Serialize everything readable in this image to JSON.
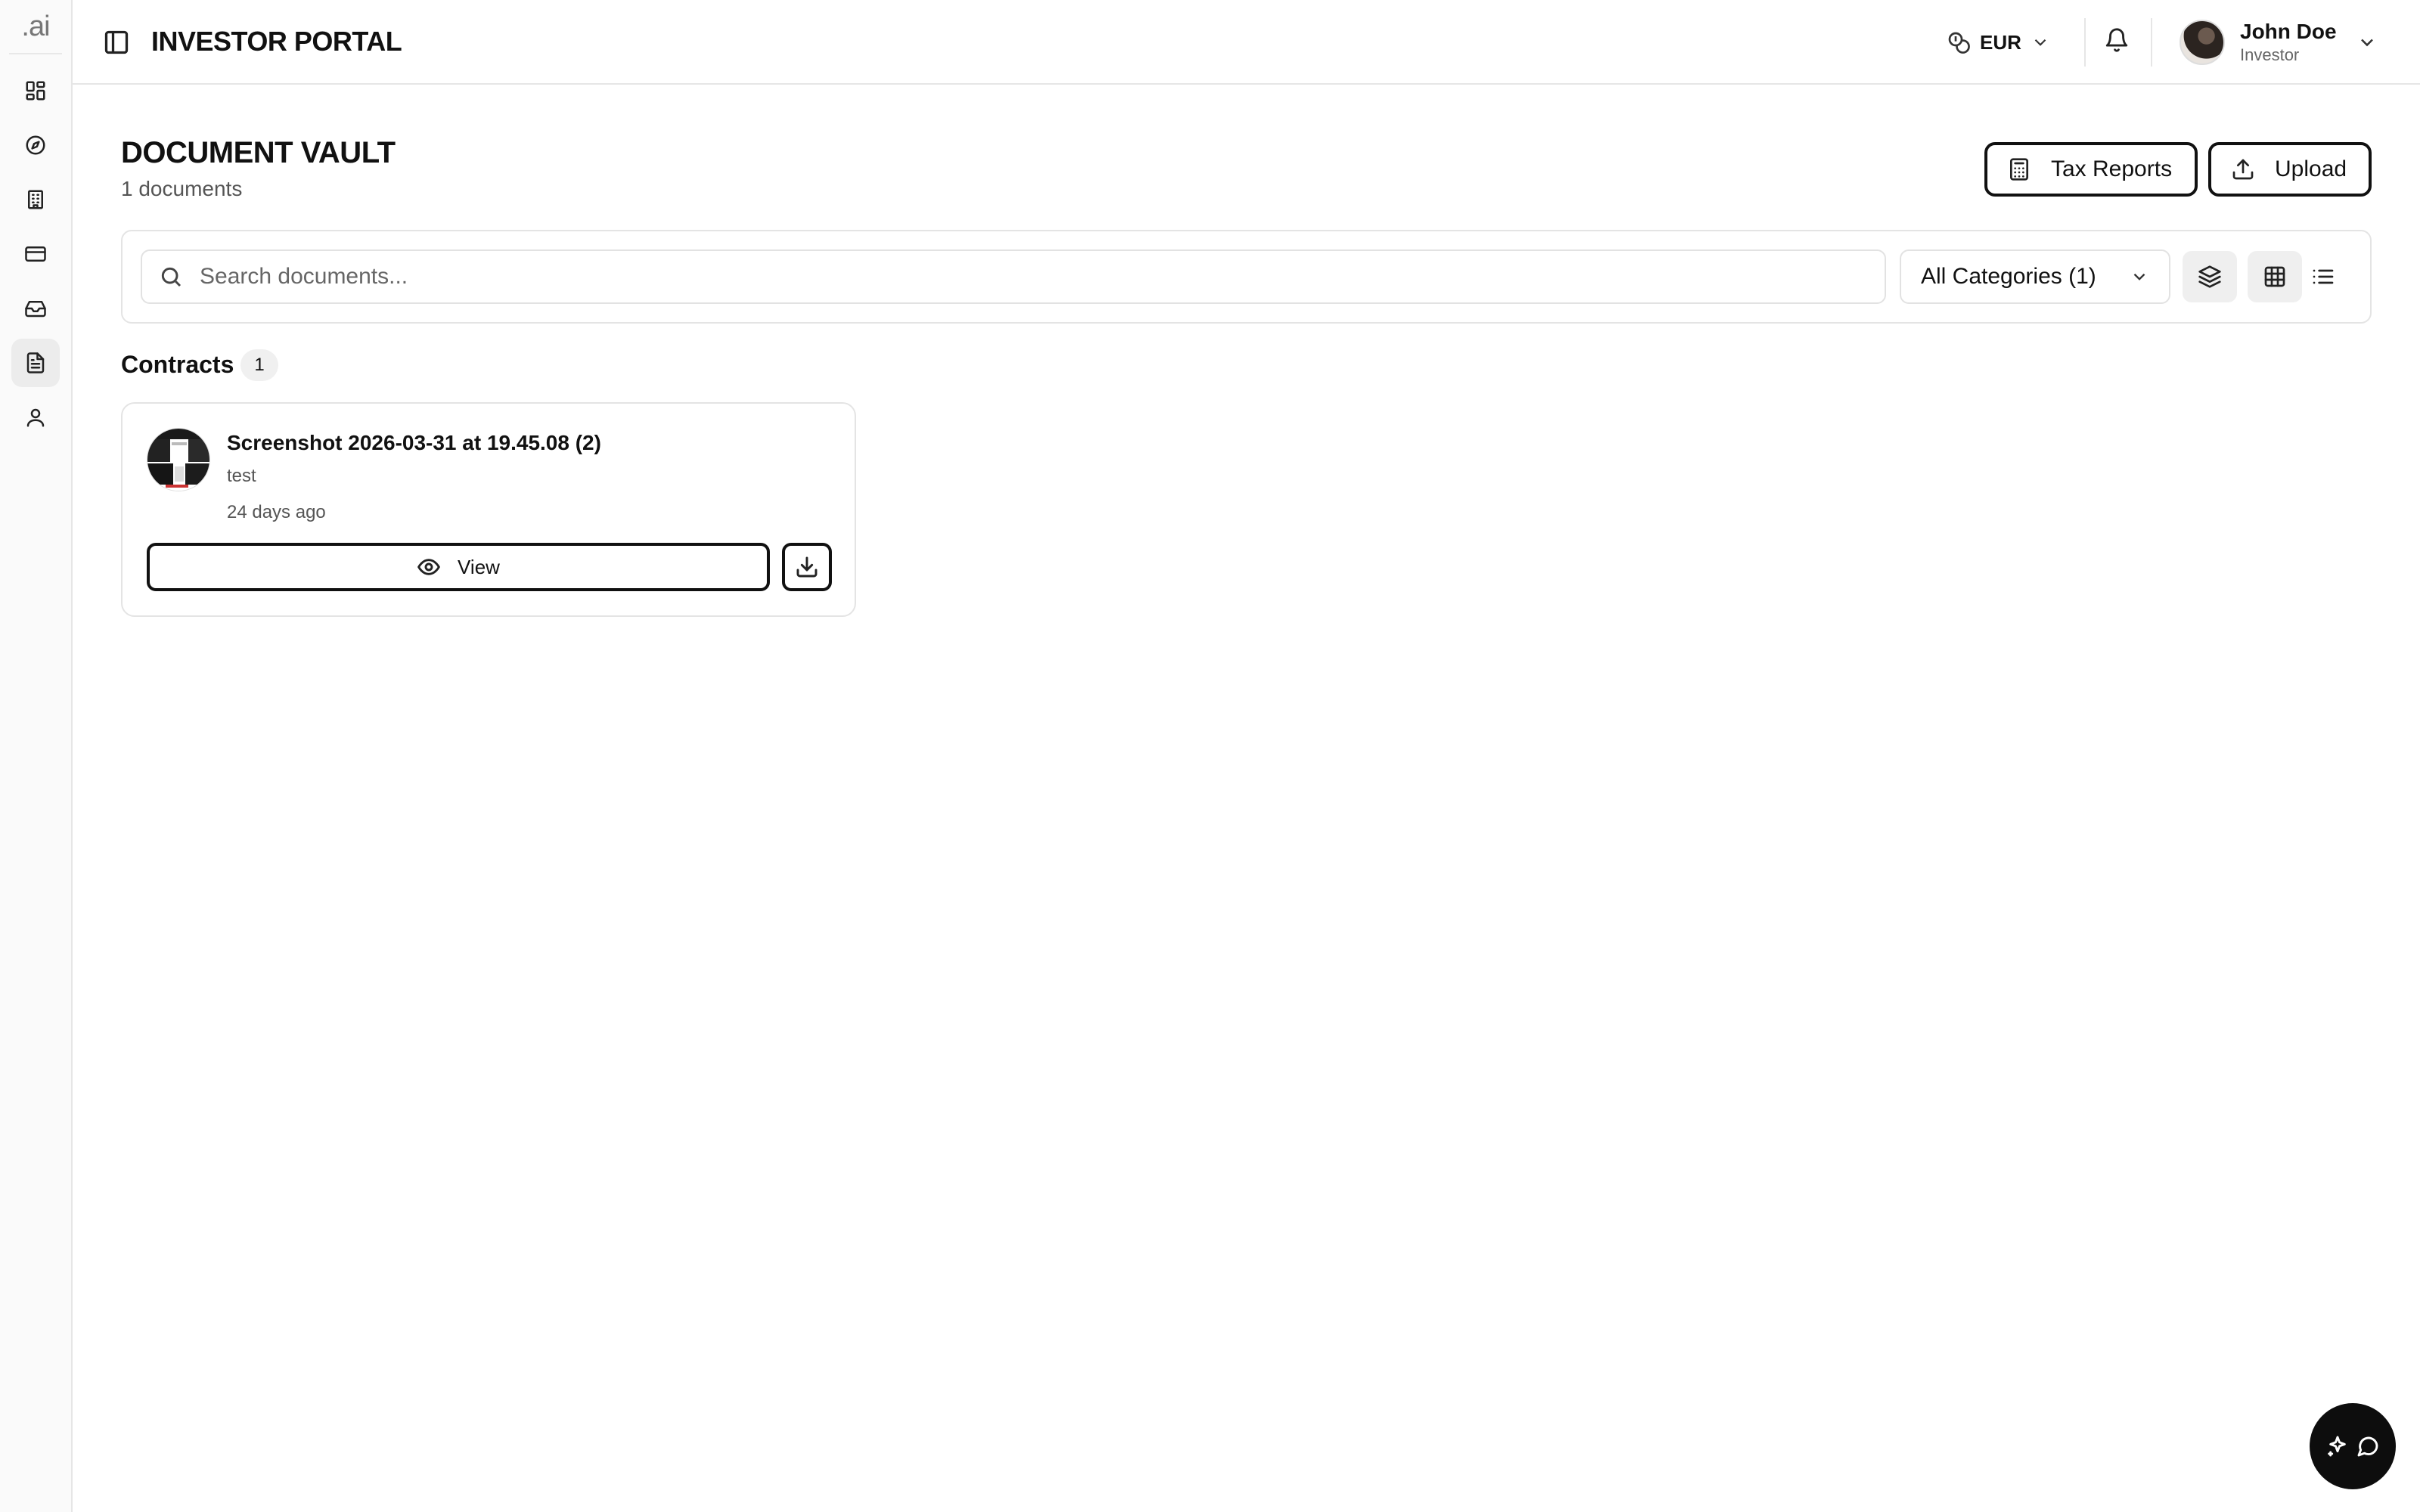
{
  "brand": {
    "logo_text": ".ai"
  },
  "sidebar": {
    "items": [
      {
        "name": "dashboard",
        "icon": "layout-dashboard-icon",
        "active": false
      },
      {
        "name": "explore",
        "icon": "compass-icon",
        "active": false
      },
      {
        "name": "properties",
        "icon": "building-icon",
        "active": false
      },
      {
        "name": "payments",
        "icon": "credit-card-icon",
        "active": false
      },
      {
        "name": "inbox",
        "icon": "inbox-icon",
        "active": false
      },
      {
        "name": "documents",
        "icon": "file-text-icon",
        "active": true
      },
      {
        "name": "profile",
        "icon": "user-icon",
        "active": false
      }
    ]
  },
  "header": {
    "title": "INVESTOR PORTAL",
    "currency": "EUR",
    "user": {
      "name": "John Doe",
      "role": "Investor"
    }
  },
  "page": {
    "title": "DOCUMENT VAULT",
    "count_text": "1 documents",
    "buttons": {
      "tax_reports": "Tax Reports",
      "upload": "Upload"
    }
  },
  "toolbar": {
    "search_placeholder": "Search documents...",
    "search_value": "",
    "category_selected": "All Categories (1)",
    "view_mode": "grid"
  },
  "sections": [
    {
      "title": "Contracts",
      "count": "1",
      "documents": [
        {
          "name": "Screenshot 2026-03-31 at 19.45.08 (2)",
          "description": "test",
          "time": "24 days ago",
          "view_label": "View"
        }
      ]
    }
  ],
  "colors": {
    "primary": "#111111",
    "border": "#e4e4e4",
    "muted": "#555555",
    "fab": "#0d0d0d"
  }
}
